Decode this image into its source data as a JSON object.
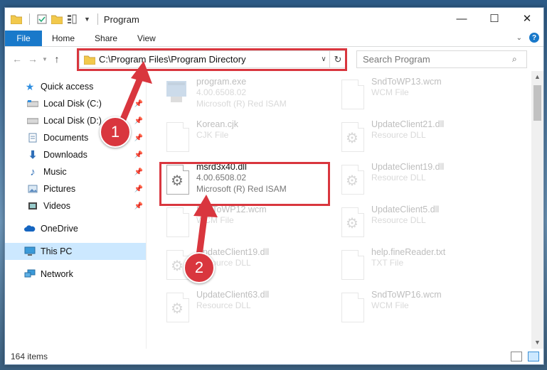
{
  "window": {
    "title": "Program",
    "minimize": "—",
    "maximize": "☐",
    "close": "✕"
  },
  "ribbon": {
    "tabs": [
      "File",
      "Home",
      "Share",
      "View"
    ]
  },
  "address": {
    "path": "C:\\Program Files\\Program Directory"
  },
  "search": {
    "placeholder": "Search Program"
  },
  "nav": {
    "items": [
      {
        "label": "Quick access",
        "icon": "star-icon"
      },
      {
        "label": "Local Disk (C:)",
        "icon": "drive-icon"
      },
      {
        "label": "Local Disk (D:)",
        "icon": "drive-icon"
      },
      {
        "label": "Documents",
        "icon": "documents-icon"
      },
      {
        "label": "Downloads",
        "icon": "download-icon"
      },
      {
        "label": "Music",
        "icon": "music-icon"
      },
      {
        "label": "Pictures",
        "icon": "pictures-icon"
      },
      {
        "label": "Videos",
        "icon": "videos-icon"
      },
      {
        "label": "OneDrive",
        "icon": "cloud-icon"
      },
      {
        "label": "This PC",
        "icon": "computer-icon"
      },
      {
        "label": "Network",
        "icon": "network-icon"
      }
    ]
  },
  "files": {
    "f0": {
      "name": "program.exe",
      "l2": "4.00.6508.02",
      "l3": "Microsoft (R) Red ISAM"
    },
    "f1": {
      "name": "SndToWP13.wcm",
      "l2": "WCM File",
      "l3": ""
    },
    "f2": {
      "name": "Korean.cjk",
      "l2": "CJK File",
      "l3": ""
    },
    "f3": {
      "name": "UpdateClient21.dll",
      "l2": "Resource DLL",
      "l3": ""
    },
    "f4": {
      "name": "msrd3x40.dll",
      "l2": "4.00.6508.02",
      "l3": "Microsoft (R) Red ISAM"
    },
    "f5": {
      "name": "UpdateClient19.dll",
      "l2": "Resource DLL",
      "l3": ""
    },
    "f6": {
      "name": "SndToWP12.wcm",
      "l2": "WCM File",
      "l3": ""
    },
    "f7": {
      "name": "UpdateClient5.dll",
      "l2": "Resource DLL",
      "l3": ""
    },
    "f8": {
      "name": "UpdateClient19.dll",
      "l2": "Resource DLL",
      "l3": ""
    },
    "f9": {
      "name": "help.fineReader.txt",
      "l2": "TXT File",
      "l3": ""
    },
    "f10": {
      "name": "UpdateClient63.dll",
      "l2": "Resource DLL",
      "l3": ""
    },
    "f11": {
      "name": "SndToWP16.wcm",
      "l2": "WCM File",
      "l3": ""
    }
  },
  "status": {
    "count": "164 items"
  },
  "annotations": {
    "step1": "1",
    "step2": "2"
  },
  "colors": {
    "accent": "#1979ca",
    "highlight": "#d9363e",
    "selected": "#cce8ff"
  }
}
